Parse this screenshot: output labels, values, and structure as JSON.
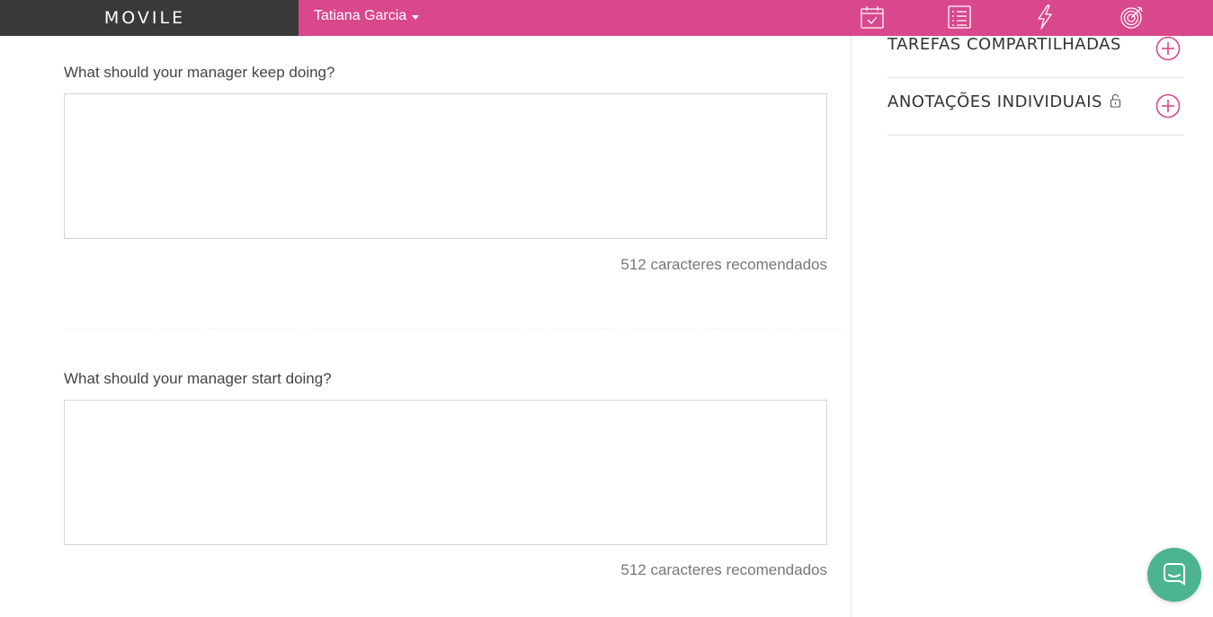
{
  "brand": {
    "logo_text": "MOVILE",
    "bar_color": "#3a3a3a"
  },
  "header": {
    "color": "#d9478c",
    "user_name": "Tatiana Garcia",
    "nav_icons": [
      "calendar-check-icon",
      "list-icon",
      "lightning-icon",
      "target-icon"
    ]
  },
  "form": {
    "questions": [
      {
        "label": "What should your manager keep doing?",
        "value": "",
        "hint": "512 caracteres recomendados"
      },
      {
        "label": "What should your manager start doing?",
        "value": "",
        "hint": "512 caracteres recomendados"
      }
    ]
  },
  "sidebar": {
    "accent_color": "#d9478c",
    "sections": [
      {
        "title": "TAREFAS COMPARTILHADAS",
        "icon": "plus-circle-icon"
      },
      {
        "title": "ANOTAÇÕES INDIVIDUAIS",
        "icon": "plus-circle-icon",
        "lock_icon": "lock-icon"
      }
    ]
  },
  "chat": {
    "icon": "chat-bubble-icon",
    "color": "#4cb58f"
  }
}
